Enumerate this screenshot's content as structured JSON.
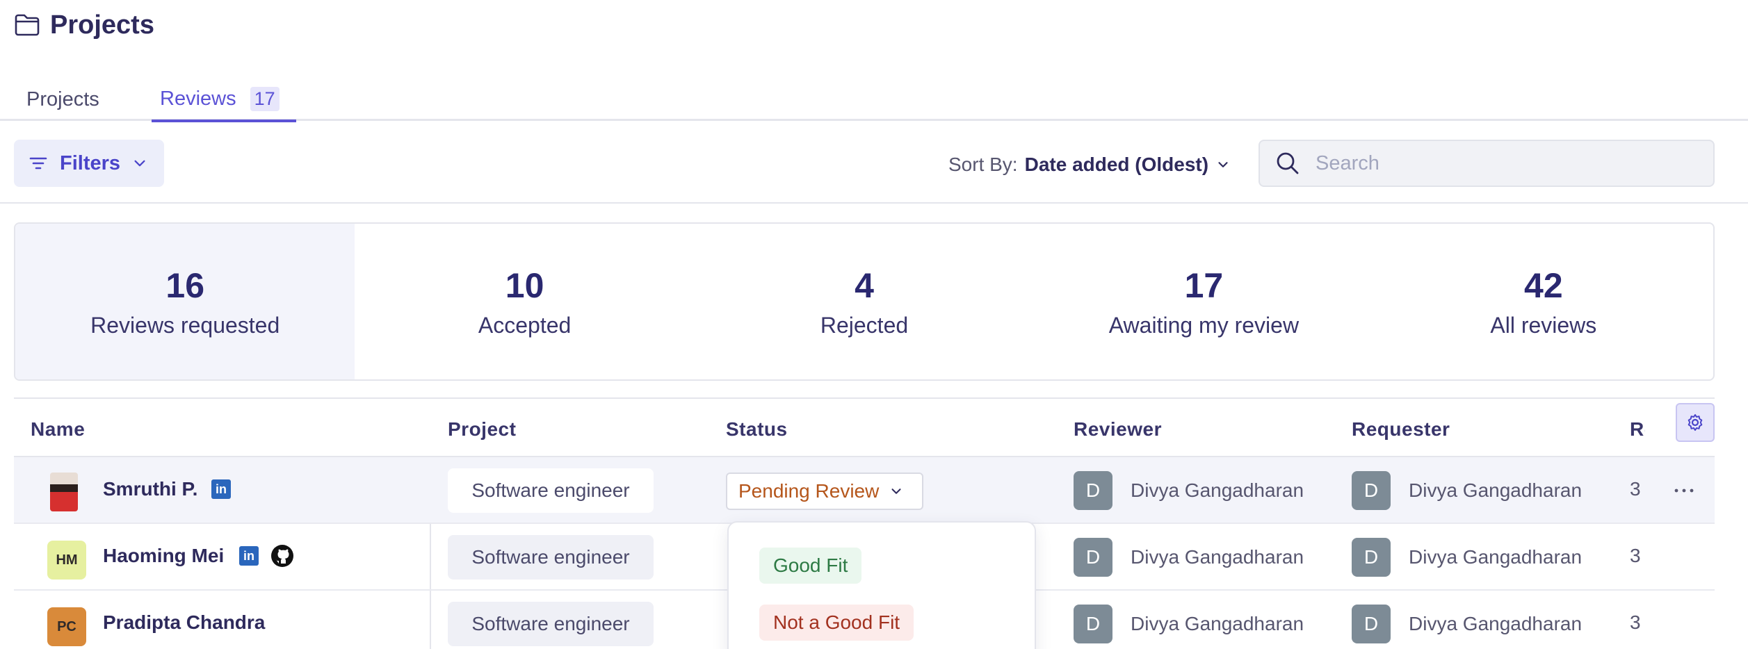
{
  "page": {
    "title": "Projects",
    "icon": "folder-icon"
  },
  "tabs": [
    {
      "label": "Projects",
      "active": false
    },
    {
      "label": "Reviews",
      "active": true,
      "badge": "17"
    }
  ],
  "toolbar": {
    "filters_label": "Filters",
    "sort_label": "Sort By:",
    "sort_value": "Date added (Oldest)",
    "search_placeholder": "Search"
  },
  "stats": [
    {
      "value": "16",
      "label": "Reviews requested",
      "active": true
    },
    {
      "value": "10",
      "label": "Accepted"
    },
    {
      "value": "4",
      "label": "Rejected"
    },
    {
      "value": "17",
      "label": "Awaiting my review"
    },
    {
      "value": "42",
      "label": "All reviews"
    }
  ],
  "table": {
    "columns": [
      "Name",
      "Project",
      "Status",
      "Reviewer",
      "Requester",
      "Rc"
    ],
    "rows": [
      {
        "name": "Smruthi P.",
        "avatar": "photo",
        "links": [
          "linkedin-icon"
        ],
        "project": "Software engineer",
        "status": "Pending Review",
        "reviewer": "Divya Gangadharan",
        "reviewer_initial": "D",
        "requester": "Divya Gangadharan",
        "requester_initial": "D",
        "count": "3"
      },
      {
        "name": "Haoming Mei",
        "avatar_initials": "HM",
        "avatar_color": "#e6f0a0",
        "links": [
          "linkedin-icon",
          "github-icon"
        ],
        "project": "Software engineer",
        "reviewer": "Divya Gangadharan",
        "reviewer_initial": "D",
        "requester": "Divya Gangadharan",
        "requester_initial": "D",
        "count": "3"
      },
      {
        "name": "Pradipta Chandra",
        "avatar_initials": "PC",
        "avatar_color": "#d98a3a",
        "project": "Software engineer",
        "reviewer": "Divya Gangadharan",
        "reviewer_initial": "D",
        "requester": "Divya Gangadharan",
        "requester_initial": "D",
        "count": "3"
      }
    ]
  },
  "status_menu": {
    "options": [
      {
        "label": "Good Fit"
      },
      {
        "label": "Not a Good Fit"
      }
    ]
  },
  "colors": {
    "accent": "#5b52d6",
    "pending": "#b5561b",
    "good": "#2d7a44",
    "bad": "#a2311f"
  }
}
